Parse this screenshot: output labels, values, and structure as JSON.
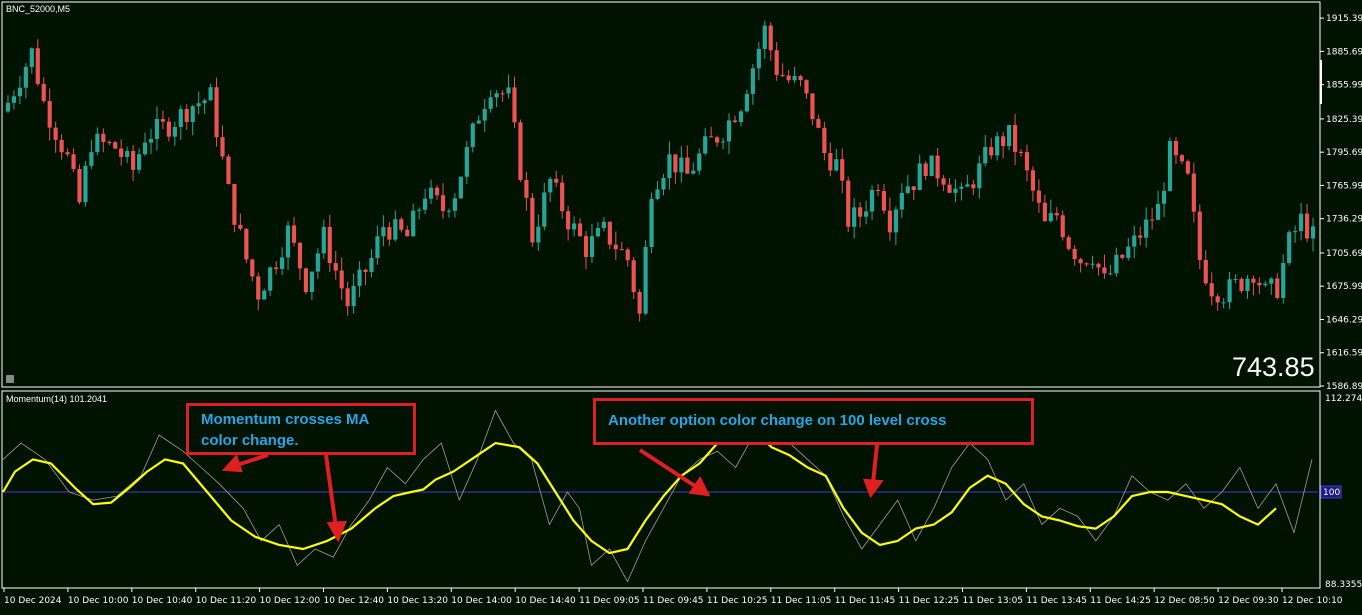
{
  "window": {
    "symbol_label": "BNC_52000,M5",
    "indicator_label": "Momentum(14) 101.2041",
    "big_number": "743.85"
  },
  "colors": {
    "background": "#001200",
    "bull_candle": "#26a69a",
    "bear_candle": "#ef5350",
    "momentum_line": "#9e9e9e",
    "ma_line": "#ffff00",
    "level_line": "#3f3fd0",
    "annotation_border": "#e02020",
    "annotation_text": "#27a6e8"
  },
  "annotations": [
    {
      "line1": "Momentum crosses MA",
      "line2": "color change."
    },
    {
      "line1": "Another option color change on 100 level cross",
      "line2": ""
    }
  ],
  "price_axis_labels": [
    "1915.39",
    "1885.69",
    "1855.99",
    "1825.39",
    "1795.69",
    "1765.99",
    "1736.29",
    "1705.69",
    "1675.99",
    "1646.29",
    "1616.59",
    "1586.89"
  ],
  "indicator_axis_labels": {
    "top": "112.2742",
    "level": "100",
    "bottom": "88.3355"
  },
  "time_axis_labels": [
    "10 Dec 2024",
    "10 Dec 10:00",
    "10 Dec 10:40",
    "10 Dec 11:20",
    "10 Dec 12:00",
    "10 Dec 12:40",
    "10 Dec 13:20",
    "10 Dec 14:00",
    "10 Dec 14:40",
    "11 Dec 09:05",
    "11 Dec 09:45",
    "11 Dec 10:25",
    "11 Dec 11:05",
    "11 Dec 11:45",
    "11 Dec 12:25",
    "11 Dec 13:05",
    "11 Dec 13:45",
    "11 Dec 14:25",
    "12 Dec 08:50",
    "12 Dec 09:30",
    "12 Dec 10:10"
  ],
  "chart_data": [
    {
      "type": "candlestick",
      "title": "BNC_52000,M5",
      "ylim": [
        1586.89,
        1928
      ],
      "anchor_closes": [
        [
          0,
          1840
        ],
        [
          4,
          1885
        ],
        [
          6,
          1840
        ],
        [
          10,
          1790
        ],
        [
          12,
          1750
        ],
        [
          14,
          1805
        ],
        [
          18,
          1800
        ],
        [
          21,
          1780
        ],
        [
          23,
          1810
        ],
        [
          27,
          1820
        ],
        [
          31,
          1838
        ],
        [
          34,
          1845
        ],
        [
          37,
          1760
        ],
        [
          40,
          1700
        ],
        [
          42,
          1670
        ],
        [
          45,
          1700
        ],
        [
          47,
          1725
        ],
        [
          50,
          1680
        ],
        [
          53,
          1720
        ],
        [
          57,
          1660
        ],
        [
          61,
          1700
        ],
        [
          63,
          1730
        ],
        [
          67,
          1720
        ],
        [
          70,
          1760
        ],
        [
          73,
          1745
        ],
        [
          75,
          1760
        ],
        [
          79,
          1830
        ],
        [
          81,
          1855
        ],
        [
          84,
          1845
        ],
        [
          86,
          1780
        ],
        [
          88,
          1720
        ],
        [
          91,
          1770
        ],
        [
          94,
          1735
        ],
        [
          97,
          1710
        ],
        [
          100,
          1725
        ],
        [
          104,
          1700
        ],
        [
          106,
          1650
        ],
        [
          108,
          1765
        ],
        [
          111,
          1790
        ],
        [
          114,
          1775
        ],
        [
          117,
          1800
        ],
        [
          120,
          1815
        ],
        [
          123,
          1840
        ],
        [
          127,
          1905
        ],
        [
          129,
          1870
        ],
        [
          131,
          1860
        ],
        [
          133,
          1855
        ],
        [
          135,
          1830
        ],
        [
          137,
          1795
        ],
        [
          139,
          1785
        ],
        [
          141,
          1735
        ],
        [
          143,
          1740
        ],
        [
          146,
          1770
        ],
        [
          148,
          1735
        ],
        [
          150,
          1765
        ],
        [
          152,
          1770
        ],
        [
          154,
          1785
        ],
        [
          157,
          1775
        ],
        [
          160,
          1755
        ],
        [
          163,
          1780
        ],
        [
          165,
          1800
        ],
        [
          168,
          1810
        ],
        [
          170,
          1790
        ],
        [
          172,
          1760
        ],
        [
          174,
          1730
        ],
        [
          176,
          1740
        ],
        [
          178,
          1715
        ],
        [
          180,
          1700
        ],
        [
          182,
          1705
        ],
        [
          184,
          1680
        ],
        [
          186,
          1695
        ],
        [
          189,
          1715
        ],
        [
          191,
          1730
        ],
        [
          193,
          1745
        ],
        [
          195,
          1795
        ],
        [
          198,
          1770
        ],
        [
          200,
          1700
        ],
        [
          202,
          1675
        ],
        [
          204,
          1670
        ],
        [
          207,
          1680
        ],
        [
          209,
          1690
        ],
        [
          211,
          1670
        ],
        [
          213,
          1675
        ],
        [
          215,
          1715
        ],
        [
          217,
          1735
        ],
        [
          219,
          1720
        ]
      ],
      "candle_count": 220
    },
    {
      "type": "line",
      "title": "Momentum(14) 101.2041",
      "ylim": [
        88.3355,
        112.2742
      ],
      "level": 100,
      "series": [
        {
          "name": "Momentum(14)",
          "color": "#9e9e9e",
          "points": [
            [
              0,
              104
            ],
            [
              3,
              106
            ],
            [
              7,
              104
            ],
            [
              11,
              100
            ],
            [
              15,
              99
            ],
            [
              19,
              99.5
            ],
            [
              23,
              102
            ],
            [
              26,
              107
            ],
            [
              30,
              105
            ],
            [
              33,
              103
            ],
            [
              36,
              101
            ],
            [
              40,
              98
            ],
            [
              43,
              94
            ],
            [
              46,
              96
            ],
            [
              49,
              91
            ],
            [
              52,
              93
            ],
            [
              55,
              92
            ],
            [
              58,
              96
            ],
            [
              61,
              99
            ],
            [
              64,
              103
            ],
            [
              67,
              101
            ],
            [
              70,
              104
            ],
            [
              73,
              106
            ],
            [
              76,
              99
            ],
            [
              79,
              104
            ],
            [
              82,
              110
            ],
            [
              85,
              106
            ],
            [
              88,
              104
            ],
            [
              91,
              96
            ],
            [
              94,
              100
            ],
            [
              96,
              98
            ],
            [
              98,
              91
            ],
            [
              101,
              93
            ],
            [
              104,
              89
            ],
            [
              107,
              94
            ],
            [
              110,
              98
            ],
            [
              113,
              102
            ],
            [
              116,
              104
            ],
            [
              119,
              105
            ],
            [
              122,
              103
            ],
            [
              125,
              107
            ],
            [
              128,
              111
            ],
            [
              131,
              106
            ],
            [
              134,
              104
            ],
            [
              137,
              102
            ],
            [
              140,
              97
            ],
            [
              143,
              93
            ],
            [
              146,
              96
            ],
            [
              149,
              99
            ],
            [
              152,
              94
            ],
            [
              155,
              98
            ],
            [
              158,
              103
            ],
            [
              161,
              106
            ],
            [
              164,
              104
            ],
            [
              167,
              99
            ],
            [
              170,
              101
            ],
            [
              173,
              96
            ],
            [
              176,
              98
            ],
            [
              179,
              97
            ],
            [
              182,
              94
            ],
            [
              185,
              97
            ],
            [
              188,
              102
            ],
            [
              191,
              100
            ],
            [
              194,
              99
            ],
            [
              197,
              101
            ],
            [
              200,
              98
            ],
            [
              203,
              100
            ],
            [
              206,
              103
            ],
            [
              209,
              98
            ],
            [
              212,
              101
            ],
            [
              215,
              95
            ],
            [
              218,
              104
            ]
          ]
        },
        {
          "name": "MA",
          "color": "#ffff00",
          "points": [
            [
              0,
              100
            ],
            [
              2,
              102.5
            ],
            [
              5,
              104
            ],
            [
              8,
              103.5
            ],
            [
              12,
              100.5
            ],
            [
              15,
              98.5
            ],
            [
              18,
              98.7
            ],
            [
              21,
              100.5
            ],
            [
              24,
              102.5
            ],
            [
              27,
              104
            ],
            [
              30,
              103.5
            ],
            [
              34,
              100
            ],
            [
              38,
              96.5
            ],
            [
              42,
              94.5
            ],
            [
              46,
              93.5
            ],
            [
              50,
              93
            ],
            [
              54,
              94
            ],
            [
              58,
              95.5
            ],
            [
              62,
              98
            ],
            [
              65,
              99.5
            ],
            [
              68,
              100
            ],
            [
              70,
              100.3
            ],
            [
              72,
              101.5
            ],
            [
              75,
              102.5
            ],
            [
              79,
              104.5
            ],
            [
              82,
              106
            ],
            [
              86,
              105.5
            ],
            [
              89,
              103.5
            ],
            [
              92,
              100
            ],
            [
              95,
              96.5
            ],
            [
              98,
              94
            ],
            [
              101,
              92.5
            ],
            [
              104,
              93
            ],
            [
              107,
              96.5
            ],
            [
              110,
              99.5
            ],
            [
              113,
              102
            ],
            [
              116,
              103.5
            ],
            [
              119,
              106
            ],
            [
              122,
              107
            ],
            [
              125,
              107.5
            ],
            [
              128,
              105.5
            ],
            [
              131,
              104.5
            ],
            [
              134,
              103
            ],
            [
              137,
              102
            ],
            [
              140,
              98
            ],
            [
              143,
              95
            ],
            [
              146,
              93.5
            ],
            [
              149,
              94
            ],
            [
              152,
              95.5
            ],
            [
              155,
              96
            ],
            [
              158,
              97.5
            ],
            [
              161,
              100.5
            ],
            [
              164,
              102
            ],
            [
              167,
              101
            ],
            [
              170,
              98.5
            ],
            [
              173,
              97
            ],
            [
              176,
              96.5
            ],
            [
              179,
              95.8
            ],
            [
              182,
              95.5
            ],
            [
              185,
              97
            ],
            [
              188,
              99.5
            ],
            [
              191,
              100
            ],
            [
              194,
              100
            ],
            [
              197,
              99.5
            ],
            [
              200,
              99
            ],
            [
              203,
              98.5
            ],
            [
              206,
              97
            ],
            [
              209,
              96
            ],
            [
              212,
              98
            ]
          ]
        }
      ]
    }
  ]
}
